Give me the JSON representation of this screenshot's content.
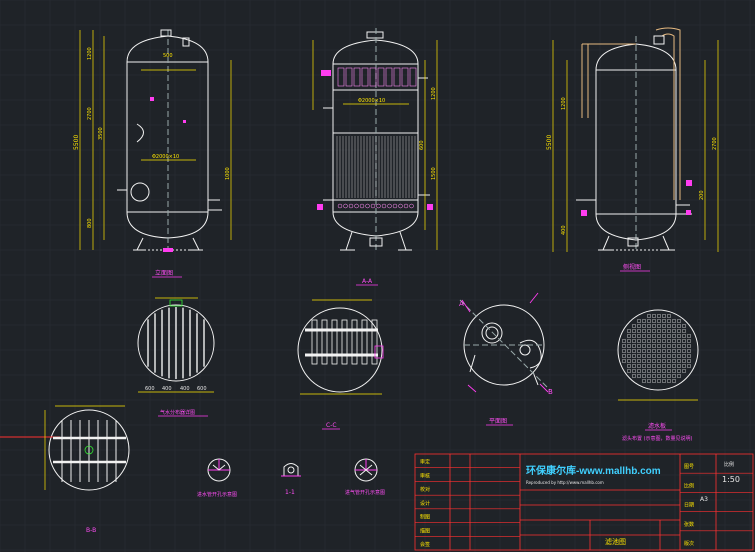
{
  "views": {
    "front_title": "立面图",
    "section_aa": "A-A",
    "side_title": "侧视图",
    "gas_title": "气水分布器详图",
    "section_cc": "C-C",
    "plan_title": "平面图",
    "filter_title": "滤水板",
    "filter_note": "滤头布置 (示意图，数量见说明)",
    "section_bb": "B-B",
    "water_left": "进水管开孔示意图",
    "section_11": "1-1",
    "water_right": "进气管开孔示意图",
    "label_a": "A",
    "label_b": "B"
  },
  "dims": {
    "dia_front": "Φ2000×10",
    "dia_section": "Φ2000×10",
    "height_front": "5500",
    "height_side": "5500",
    "h_2700": "2700",
    "h_1200": "1200",
    "h_3500": "3500",
    "h_800": "800",
    "h_400": "400",
    "h_600": "600",
    "h_200": "200",
    "h_1000": "1000",
    "h_1500": "1500",
    "top_500": "500",
    "b_1": "600",
    "b_2": "400",
    "b_3": "400",
    "b_4": "600"
  },
  "title_block": {
    "company": "环保康尔库-www.mallhb.com",
    "subtitle": "Reproduced by http://www.mallhb.com",
    "scale_label": "比例",
    "scale": "1:50",
    "sheet_code": "A3",
    "drawing_name": "滤池图",
    "rows": [
      "审定",
      "审核",
      "校对",
      "设计",
      "制图",
      "描图",
      "会签"
    ],
    "right_rows": [
      "图号",
      "比例",
      "日期",
      "张数",
      "版次"
    ]
  },
  "colors": {
    "background": "#1f2328",
    "grid": "#2e343b",
    "outline": "#f2f2f2",
    "dimension": "#ffe600",
    "accent": "#ff3df0",
    "frame_red": "#ff3030",
    "pipe_green": "#33e633"
  }
}
